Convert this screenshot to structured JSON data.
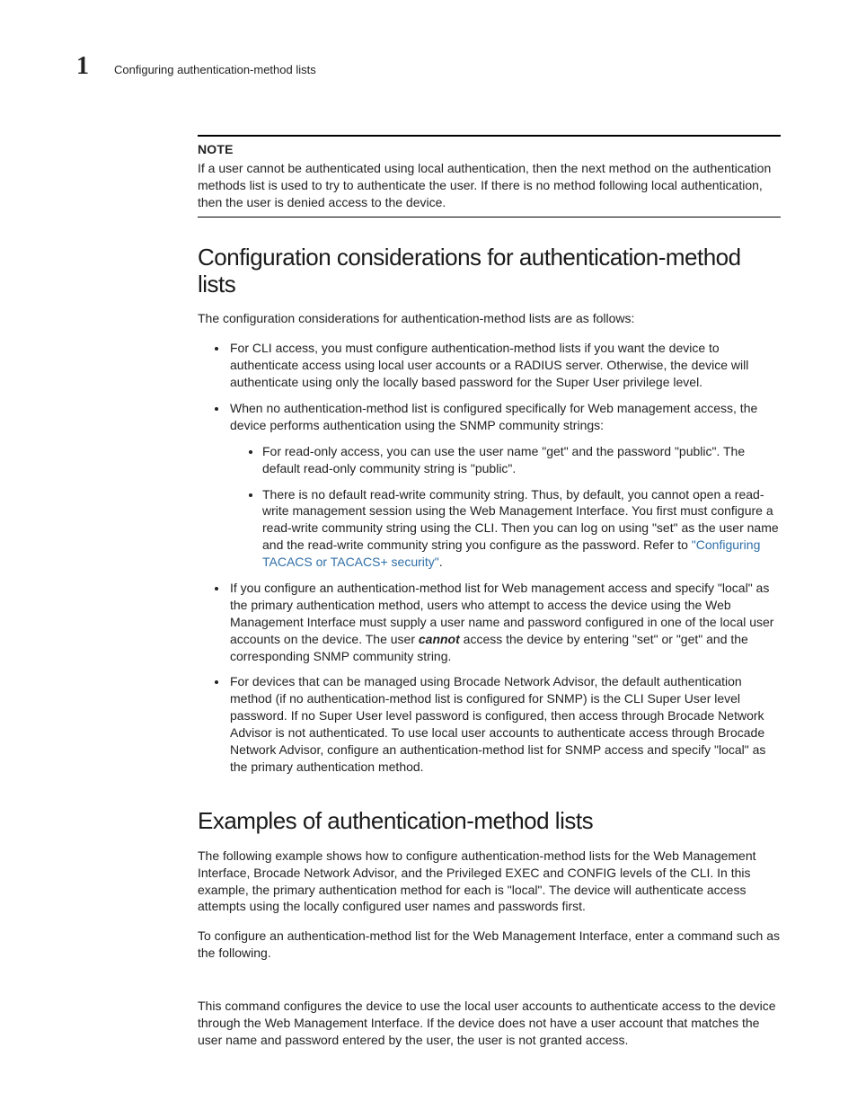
{
  "header": {
    "chapter_number": "1",
    "running_title": "Configuring authentication-method lists"
  },
  "note": {
    "label": "NOTE",
    "body": "If a user cannot be authenticated using local authentication, then the next method on the authentication methods list is used to try to authenticate the user. If there is no method following local authentication, then the user is denied access to the device."
  },
  "section1": {
    "title": "Configuration considerations for authentication-method lists",
    "intro": "The configuration considerations for authentication-method lists are as follows:",
    "b1": "For CLI access, you must configure authentication-method lists if you want the device to authenticate access using local user accounts or a RADIUS server. Otherwise, the device will authenticate using only the locally based password for the Super User privilege level.",
    "b2": "When no authentication-method list is configured specifically for Web management access, the device performs authentication using the SNMP community strings:",
    "b2_s1": "For read-only access, you can use the user name \"get\" and the password \"public\". The default read-only community string is \"public\".",
    "b2_s2_pre": "There is no default read-write community string. Thus, by default, you cannot open a read-write management session using the Web Management Interface. You first must configure a read-write community string using the CLI. Then you can log on using \"set\" as the user name and the read-write community string you configure as the password. Refer to ",
    "b2_s2_link": "\"Configuring TACACS or TACACS+ security\"",
    "b2_s2_post": ".",
    "b3_pre": "If you configure an authentication-method list for Web management access and specify \"local\" as the primary authentication method, users who attempt to access the device using the Web Management Interface must supply a user name and password configured in one of the local user accounts on the device. The user ",
    "b3_em": "cannot",
    "b3_post": " access the device by entering \"set\" or \"get\" and the corresponding SNMP community string.",
    "b4": "For devices that can be managed using Brocade Network Advisor, the default authentication method (if no authentication-method list is configured for SNMP) is the CLI Super User level password. If no Super User level password is configured, then access through Brocade Network Advisor is not authenticated. To use local user accounts to authenticate access through Brocade Network Advisor, configure an authentication-method list for SNMP access and specify \"local\" as the primary authentication method."
  },
  "section2": {
    "title": "Examples of authentication-method lists",
    "p1": "The following example shows how to configure authentication-method lists for the Web Management Interface, Brocade Network Advisor, and the Privileged EXEC and CONFIG levels of the CLI. In this example, the primary authentication method for each is \"local\". The device will authenticate access attempts using the locally configured user names and passwords first.",
    "p2": "To configure an authentication-method list for the Web Management Interface, enter a command such as the following.",
    "p3": "This command configures the device to use the local user accounts to authenticate access to the device through the Web Management Interface. If the device does not have a user account that matches the user name and password entered by the user, the user is not granted access."
  }
}
